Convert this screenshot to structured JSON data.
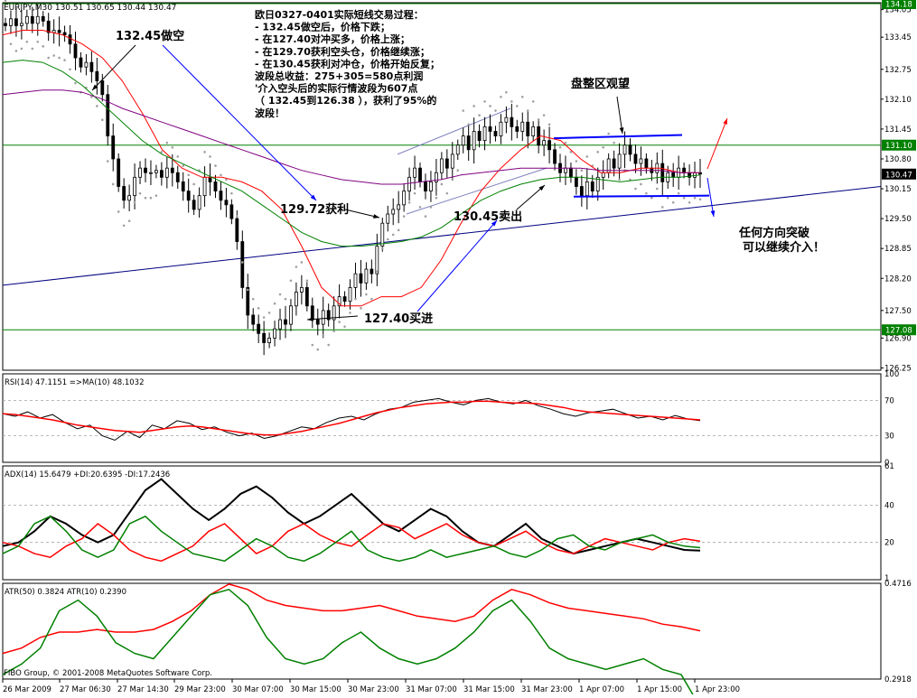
{
  "header": {
    "symbol_line": "EURJPY,M30  130.51 130.65 130.44 130.47"
  },
  "copyright": "FIBO Group, © 2001-2008 MetaQuotes Software Corp.",
  "colors": {
    "candle": "#000000",
    "ma_fast": "#ff0000",
    "ma_mid": "#008000",
    "ma_slow": "#800080",
    "sar": "#a0a0a0",
    "trend": "#000080",
    "level_line": "#008000",
    "arrow_blue": "#0000ff",
    "arrow_red": "#ff0000",
    "price_tag_bg": "#008000",
    "current_tag_bg": "#000000"
  },
  "x_ticks": [
    "26 Mar 2009",
    "27 Mar 06:30",
    "27 Mar 14:30",
    "29 Mar 23:00",
    "30 Mar 07:00",
    "30 Mar 15:00",
    "30 Mar 23:00",
    "31 Mar 07:00",
    "31 Mar 15:00",
    "31 Mar 23:00",
    "1 Apr 07:00",
    "1 Apr 15:00",
    "1 Apr 23:00"
  ],
  "annotations": {
    "title_block": [
      "欧日0327-0401实际短线交易过程：",
      "- 132.45做空后，价格下跌；",
      "- 在127.40对冲买多，价格上涨；",
      "- 在129.70获利空头仓，价格继续涨；",
      "- 在130.45获利对冲仓，价格开始反复；",
      "波段总收益：275+305=580点利润",
      "'介入空头后的实际行情波段为607点",
      "（ 132.45到126.38 ），获利了95%的",
      "波段！"
    ],
    "short_label": "132.45做空",
    "profit_label": "129.72获利",
    "sell_label": "130.45卖出",
    "buy_label": "127.40买进",
    "range_label": "盘整区观望",
    "breakout_label_1": "任何方向突破",
    "breakout_label_2": "可以继续介入！"
  },
  "chart_data": [
    {
      "type": "candlestick",
      "title": "EURJPY,M30  130.51 130.65 130.44 130.47",
      "ylim": [
        126.2,
        134.2
      ],
      "y_ticks": [
        134.05,
        133.45,
        132.75,
        132.1,
        131.45,
        130.8,
        130.15,
        129.5,
        128.85,
        128.2,
        127.5,
        126.9,
        126.25
      ],
      "price_tags": [
        {
          "value": 134.18,
          "label": "134.18",
          "role": "level"
        },
        {
          "value": 131.1,
          "label": "131.10",
          "role": "level"
        },
        {
          "value": 130.47,
          "label": "130.47",
          "role": "current"
        },
        {
          "value": 127.08,
          "label": "127.08",
          "role": "level"
        }
      ],
      "horizontal_levels": [
        134.18,
        131.1,
        127.08
      ],
      "close": [
        133.7,
        133.85,
        133.7,
        133.75,
        133.9,
        133.75,
        133.9,
        133.8,
        133.55,
        133.6,
        133.55,
        133.5,
        133.3,
        133.0,
        132.8,
        132.9,
        132.7,
        132.5,
        132.2,
        131.3,
        130.8,
        130.2,
        129.9,
        130.0,
        130.4,
        130.6,
        130.5,
        130.5,
        130.55,
        130.4,
        130.6,
        130.5,
        130.3,
        130.1,
        129.9,
        129.7,
        130.0,
        130.4,
        130.3,
        130.1,
        129.9,
        129.8,
        129.5,
        129.0,
        128.0,
        127.4,
        127.2,
        127.0,
        126.8,
        126.9,
        127.1,
        127.3,
        127.2,
        127.6,
        127.9,
        128.0,
        127.6,
        127.3,
        127.2,
        127.5,
        127.3,
        127.6,
        127.8,
        127.7,
        128.0,
        128.3,
        128.1,
        128.4,
        128.3,
        128.9,
        129.4,
        129.6,
        129.7,
        129.8,
        130.1,
        130.4,
        130.6,
        130.3,
        130.1,
        130.3,
        130.5,
        130.8,
        130.6,
        130.9,
        131.1,
        131.3,
        131.0,
        131.4,
        131.2,
        131.5,
        131.4,
        131.3,
        131.6,
        131.7,
        131.5,
        131.4,
        131.6,
        131.3,
        131.5,
        131.1,
        131.2,
        131.0,
        130.7,
        130.5,
        130.6,
        130.4,
        130.2,
        130.0,
        130.3,
        130.1,
        130.4,
        130.5,
        130.8,
        130.6,
        130.9,
        131.1,
        130.9,
        130.7,
        130.8,
        130.6,
        130.5,
        130.7,
        130.3,
        130.5,
        130.4,
        130.6,
        130.5,
        130.4,
        130.5,
        130.47
      ],
      "series": [
        {
          "name": "",
          "role": "ma_fast",
          "values": [
            133.5,
            133.6,
            133.6,
            133.5,
            133.3,
            133.0,
            132.5,
            131.8,
            131.0,
            130.6,
            130.4,
            130.4,
            130.3,
            130.1,
            129.7,
            128.9,
            128.0,
            127.6,
            127.6,
            127.8,
            127.8,
            128.0,
            128.6,
            129.4,
            130.1,
            130.6,
            131.0,
            131.3,
            131.2,
            130.8,
            130.5,
            130.5,
            130.6,
            130.6,
            130.5,
            130.5
          ]
        },
        {
          "name": "",
          "role": "ma_mid",
          "values": [
            132.9,
            132.95,
            132.9,
            132.7,
            132.4,
            132.0,
            131.6,
            131.2,
            130.9,
            130.7,
            130.5,
            130.3,
            130.1,
            129.8,
            129.5,
            129.2,
            129.0,
            128.9,
            128.9,
            128.95,
            129.0,
            129.1,
            129.3,
            129.6,
            129.9,
            130.1,
            130.25,
            130.35,
            130.4,
            130.4,
            130.35,
            130.3,
            130.35,
            130.4,
            130.4,
            130.45
          ]
        },
        {
          "name": "",
          "role": "ma_slow",
          "values": [
            132.2,
            132.25,
            132.3,
            132.3,
            132.25,
            132.1,
            131.9,
            131.75,
            131.6,
            131.45,
            131.3,
            131.15,
            131.0,
            130.85,
            130.7,
            130.55,
            130.45,
            130.35,
            130.3,
            130.25,
            130.25,
            130.3,
            130.35,
            130.45,
            130.5,
            130.55,
            130.6,
            130.6,
            130.6,
            130.6,
            130.55,
            130.55,
            130.55,
            130.55,
            130.5,
            130.5
          ]
        }
      ],
      "trend_lines": [
        {
          "from_value": 128.05,
          "to_value": 130.2
        },
        {
          "from_value": 130.9,
          "to_value": 131.9
        },
        {
          "from_value": 129.6,
          "to_value": 130.6
        }
      ]
    },
    {
      "type": "line",
      "title": "RSI(14) 47.1151  =>MA(10) 48.1032",
      "ylim": [
        0,
        100
      ],
      "y_ticks": [
        100,
        70,
        30,
        0
      ],
      "levels": [
        70,
        30
      ],
      "series": [
        {
          "name": "",
          "role": "rsi",
          "values": [
            55,
            52,
            57,
            50,
            54,
            45,
            38,
            42,
            30,
            25,
            35,
            28,
            42,
            38,
            47,
            44,
            37,
            40,
            34,
            30,
            33,
            27,
            30,
            35,
            40,
            38,
            45,
            50,
            52,
            48,
            55,
            60,
            62,
            68,
            70,
            72,
            68,
            65,
            70,
            72,
            68,
            66,
            70,
            64,
            60,
            55,
            52,
            56,
            58,
            60,
            55,
            50,
            52,
            48,
            53,
            49,
            47
          ]
        },
        {
          "name": "",
          "role": "rsi_ma",
          "values": [
            55,
            54,
            52,
            50,
            48,
            45,
            42,
            40,
            38,
            36,
            35,
            34,
            36,
            38,
            40,
            41,
            40,
            38,
            36,
            34,
            32,
            31,
            31,
            33,
            35,
            38,
            41,
            44,
            48,
            52,
            56,
            59,
            62,
            64,
            66,
            67,
            68,
            68,
            69,
            69,
            68,
            67,
            67,
            66,
            64,
            62,
            59,
            57,
            56,
            55,
            54,
            53,
            52,
            51,
            50,
            49,
            48
          ]
        }
      ]
    },
    {
      "type": "line",
      "title": "ADX(14) 15.6479 +DI:20.6395 -DI:17.2436",
      "ylim": [
        0,
        61
      ],
      "y_ticks": [
        61,
        40,
        20,
        1
      ],
      "levels": [
        40,
        20
      ],
      "series": [
        {
          "name": "",
          "role": "adx",
          "values": [
            18,
            20,
            26,
            34,
            30,
            24,
            20,
            24,
            36,
            48,
            54,
            46,
            38,
            32,
            38,
            46,
            50,
            44,
            36,
            30,
            34,
            40,
            46,
            38,
            30,
            26,
            32,
            38,
            34,
            26,
            20,
            18,
            24,
            30,
            22,
            18,
            14,
            16,
            18,
            20,
            22,
            20,
            18,
            16,
            15.6
          ]
        },
        {
          "name": "",
          "role": "plus_di",
          "values": [
            20,
            18,
            14,
            12,
            18,
            22,
            30,
            24,
            16,
            12,
            10,
            14,
            18,
            26,
            30,
            22,
            14,
            18,
            26,
            30,
            24,
            20,
            18,
            24,
            30,
            28,
            22,
            26,
            30,
            24,
            20,
            18,
            22,
            26,
            20,
            16,
            14,
            18,
            22,
            20,
            18,
            16,
            20,
            22,
            20.6
          ]
        },
        {
          "name": "",
          "role": "minus_di",
          "values": [
            14,
            18,
            30,
            34,
            26,
            16,
            12,
            16,
            30,
            34,
            26,
            20,
            14,
            12,
            10,
            16,
            22,
            18,
            12,
            10,
            14,
            20,
            26,
            16,
            12,
            10,
            12,
            16,
            12,
            14,
            16,
            18,
            14,
            12,
            16,
            22,
            24,
            18,
            16,
            20,
            22,
            24,
            20,
            18,
            17.2
          ]
        }
      ]
    },
    {
      "type": "line",
      "title": "ATR(50) 0.3824  ATR(10) 0.2390",
      "ylim": [
        0.2918,
        0.4716
      ],
      "y_ticks": [
        0.4716,
        0.2918
      ],
      "series": [
        {
          "name": "",
          "role": "atr50",
          "values": [
            0.34,
            0.35,
            0.37,
            0.38,
            0.38,
            0.385,
            0.38,
            0.38,
            0.385,
            0.4,
            0.42,
            0.45,
            0.47,
            0.46,
            0.44,
            0.43,
            0.425,
            0.42,
            0.42,
            0.425,
            0.43,
            0.42,
            0.41,
            0.405,
            0.4,
            0.41,
            0.44,
            0.46,
            0.45,
            0.435,
            0.425,
            0.42,
            0.415,
            0.41,
            0.405,
            0.395,
            0.39,
            0.3824
          ]
        },
        {
          "name": "",
          "role": "atr10",
          "values": [
            0.3,
            0.32,
            0.35,
            0.42,
            0.44,
            0.41,
            0.36,
            0.34,
            0.33,
            0.37,
            0.41,
            0.45,
            0.46,
            0.43,
            0.37,
            0.33,
            0.32,
            0.33,
            0.36,
            0.38,
            0.35,
            0.33,
            0.32,
            0.33,
            0.35,
            0.38,
            0.42,
            0.44,
            0.4,
            0.35,
            0.33,
            0.32,
            0.31,
            0.32,
            0.33,
            0.31,
            0.3,
            0.239
          ]
        }
      ]
    }
  ]
}
